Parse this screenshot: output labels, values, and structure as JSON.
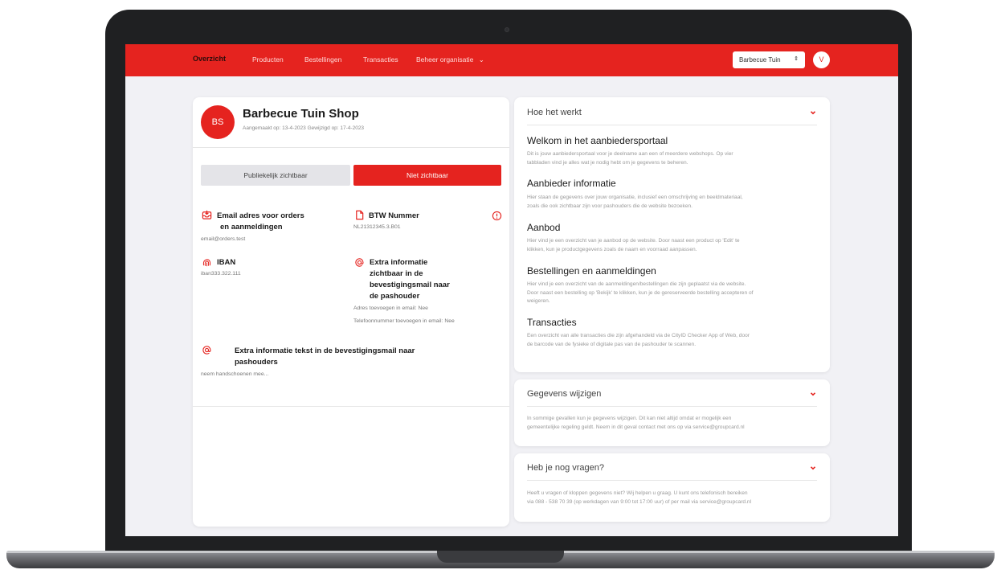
{
  "nav": {
    "items": [
      "Overzicht",
      "Producten",
      "Bestellingen",
      "Transacties",
      "Beheer organisatie"
    ],
    "org_select": "Barbecue Tuin",
    "user_initial": "V",
    "accent_color": "#e5231f"
  },
  "shop": {
    "initials": "BS",
    "name": "Barbecue Tuin Shop",
    "dates": "Aangemaakt op: 13-4-2023  Gewijzigd op: 17-4-2023",
    "visibility": {
      "public_label": "Publiekelijk zichtbaar",
      "hidden_label": "Niet zichtbaar",
      "selected": "Niet zichtbaar"
    },
    "email": {
      "label_line1": "Email adres voor orders",
      "label_line2": "en aanmeldingen",
      "value": "email@orders.test"
    },
    "btw": {
      "label": "BTW Nummer",
      "value": "NL21312345.3.B01"
    },
    "iban": {
      "label": "IBAN",
      "value": "iban333.322.111"
    },
    "extra_info": {
      "label_lines": [
        "Extra informatie",
        "zichtbaar in de",
        "bevestigingsmail naar",
        "de pashouder"
      ],
      "address_option": "Adres toevoegen in email: Nee",
      "phone_option": "Telefoonnummer toevoegen in email: Nee"
    },
    "extra_text": {
      "label_line1": "Extra informatie tekst in de bevestigingsmail naar",
      "label_line2": "pashouders",
      "value": "neem handschoenen mee..."
    }
  },
  "how_it_works": {
    "title": "Hoe het werkt",
    "sections": [
      {
        "title": "Welkom in het aanbiedersportaal",
        "lines": [
          "Dit is jouw aanbiedersportaal voor je deelname aan een of meerdere webshops. Op vier",
          "tabbladen vind je alles wat je nodig hebt om je gegevens te beheren."
        ]
      },
      {
        "title": "Aanbieder informatie",
        "lines": [
          "Hier staan de gegevens over jouw organisatie, inclusief een omschrijving en beeldmateriaal,",
          "zoals die ook zichtbaar zijn voor pashouders die de website bezoeken."
        ]
      },
      {
        "title": "Aanbod",
        "lines": [
          "Hier vind je een overzicht van je aanbod op de website. Door naast een product op 'Edit' te",
          "klikken, kun je productgegevens zoals de naam en voorraad aanpassen."
        ]
      },
      {
        "title": "Bestellingen en aanmeldingen",
        "lines": [
          "Hier vind je een overzicht van de aanmeldingen/bestellingen die zijn geplaatst via de website.",
          "Door naast een bestelling op 'Bekijk' te klikken, kun je de gereserveerde bestelling accepteren of",
          "weigeren."
        ]
      },
      {
        "title": "Transacties",
        "lines": [
          "Een overzicht van alle transacties die zijn afgehandeld via de CityID Checker App of Web, door",
          "de barcode van de fysieke of digitale pas van de pashouder te scannen."
        ]
      }
    ]
  },
  "change_data": {
    "title": "Gegevens wijzigen",
    "lines": [
      "In sommige gevallen kun je gegevens wijzigen. Dit kan niet altijd omdat er mogelijk een",
      "gemeentelijke regeling geldt. Neem in dit geval contact met ons op via service@groupcard.nl"
    ]
  },
  "questions": {
    "title": "Heb je nog vragen?",
    "lines": [
      "Heeft u vragen of kloppen gegevens niet? Wij helpen u graag. U kunt ons telefonisch bereiken",
      "via 088 - 538 70 39 (op werkdagen van 9:00 tot 17:00 uur) of per mail via service@groupcard.nl"
    ]
  }
}
